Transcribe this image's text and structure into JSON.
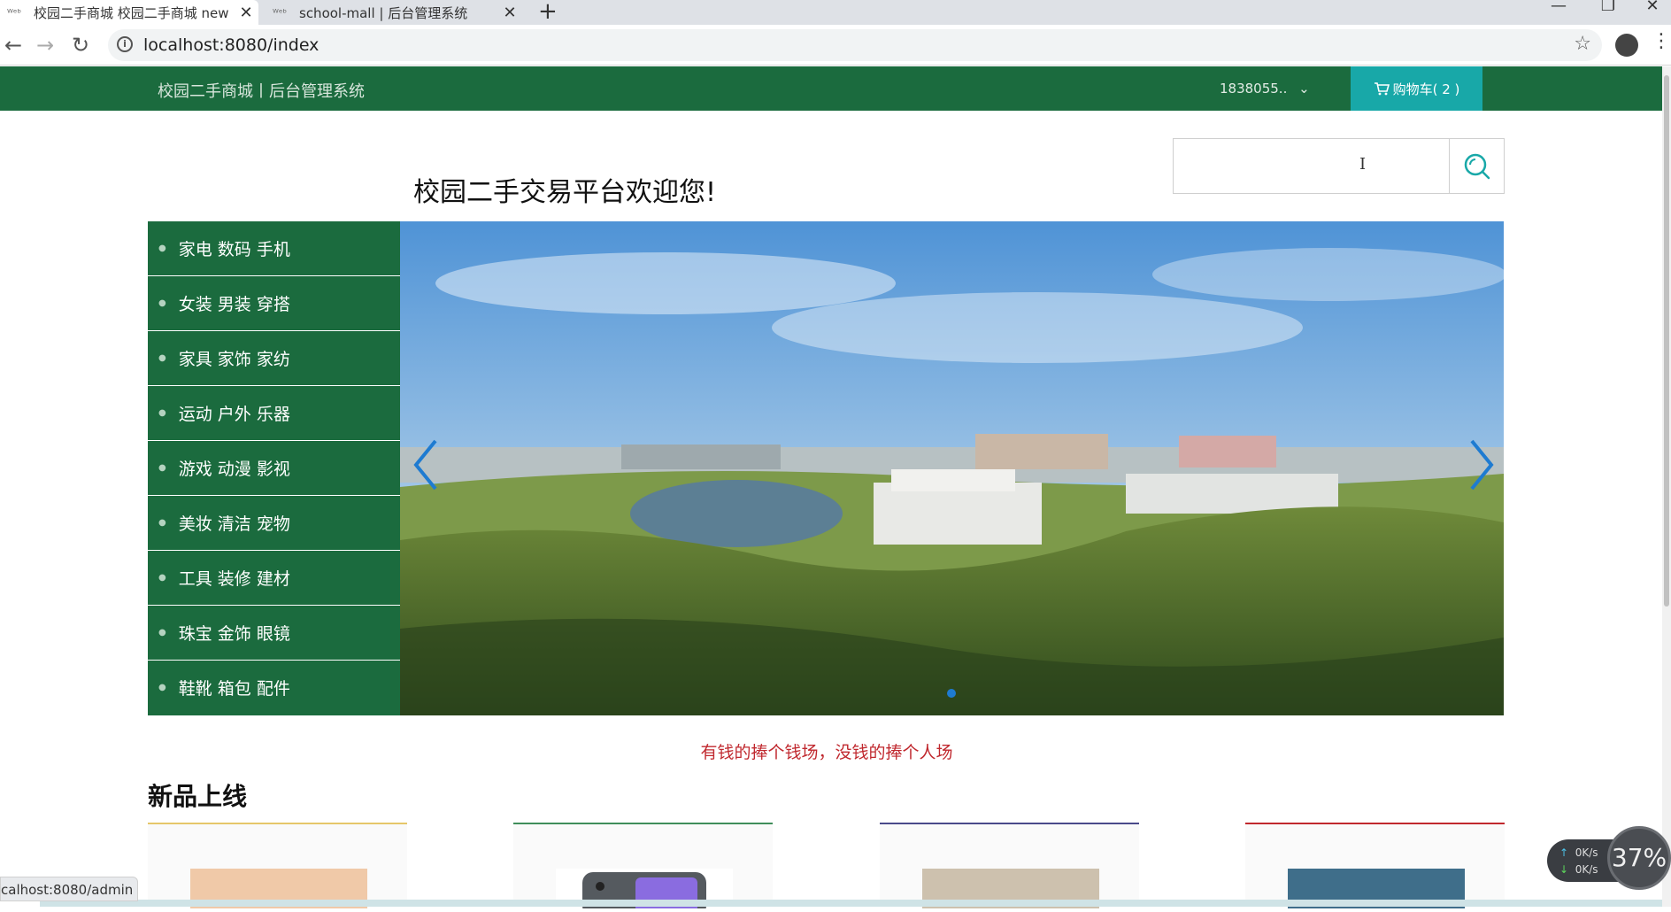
{
  "browser": {
    "tabs": [
      {
        "title": "校园二手商城 校园二手商城 new",
        "active": true
      },
      {
        "title": "school-mall | 后台管理系统",
        "active": false
      }
    ],
    "new_tab": "+",
    "url": "localhost:8080/index",
    "status_url": "calhost:8080/admin"
  },
  "topnav": {
    "brand": "校园二手商城丨后台管理系统",
    "user": "1838055..",
    "cart_label": "购物车( 2 )"
  },
  "header": {
    "welcome": "校园二手交易平台欢迎您!",
    "search_placeholder": ""
  },
  "categories": [
    "家电 数码 手机",
    "女装 男装 穿搭",
    "家具 家饰 家纺",
    "运动 户外 乐器",
    "游戏 动漫 影视",
    "美妆 清洁 宠物",
    "工具 装修 建材",
    "珠宝 金饰 眼镜",
    "鞋靴 箱包 配件"
  ],
  "slogan": "有钱的捧个钱场，没钱的捧个人场",
  "new_products": {
    "title": "新品上线",
    "accent_colors": [
      "#e6c76a",
      "#3f8e5a",
      "#4a4a8a",
      "#c0282e"
    ]
  },
  "net_widget": {
    "up": "0K/s",
    "down": "0K/s",
    "percent": "37%"
  },
  "colors": {
    "nav_green": "#1b6b3e",
    "cart_teal": "#18a8a8",
    "slogan_red": "#c0282e"
  }
}
